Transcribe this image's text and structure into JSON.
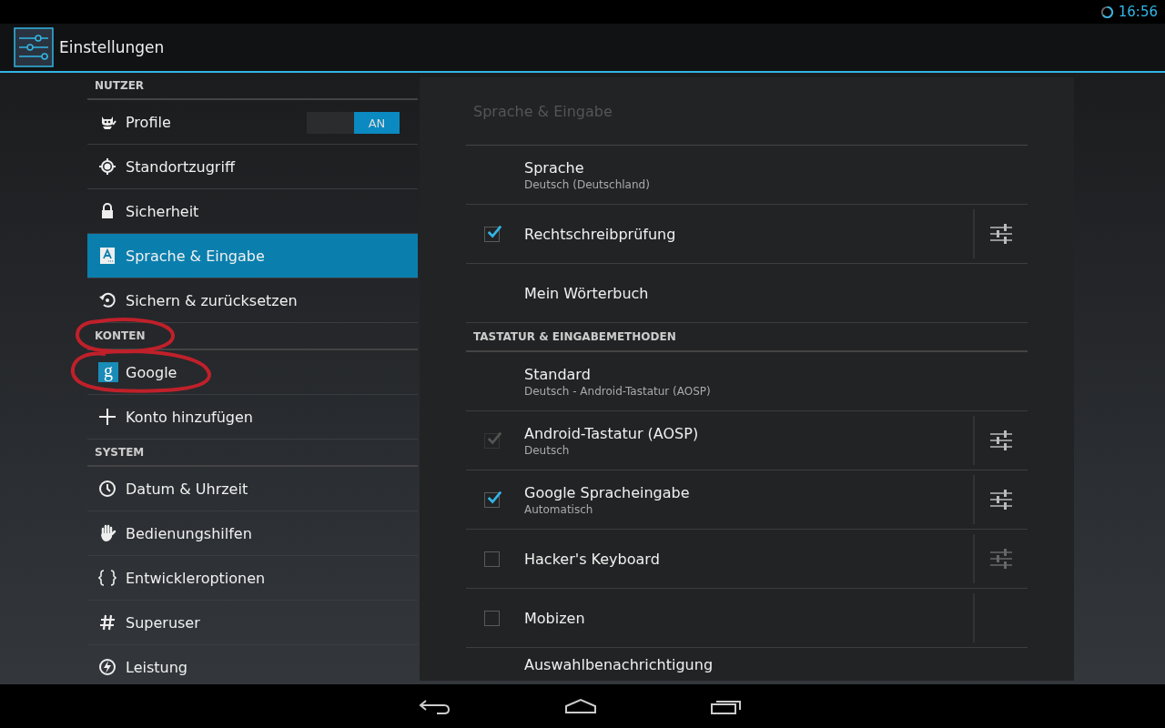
{
  "status_bar": {
    "time": "16:56"
  },
  "action_bar": {
    "title": "Einstellungen"
  },
  "sidebar": {
    "items": [
      {
        "kind": "header",
        "label": "NUTZER",
        "circled": false
      },
      {
        "kind": "item",
        "label": "Profile",
        "selected": false,
        "circled": false,
        "toggle": {
          "label": "AN",
          "on": true
        }
      },
      {
        "kind": "item",
        "label": "Standortzugriff",
        "selected": false,
        "circled": false
      },
      {
        "kind": "item",
        "label": "Sicherheit",
        "selected": false,
        "circled": false
      },
      {
        "kind": "item",
        "label": "Sprache & Eingabe",
        "selected": true,
        "circled": false
      },
      {
        "kind": "item",
        "label": "Sichern & zurücksetzen",
        "selected": false,
        "circled": false
      },
      {
        "kind": "header",
        "label": "KONTEN",
        "circled": true
      },
      {
        "kind": "item",
        "glyph": "g",
        "label": "Google",
        "selected": false,
        "circled": true
      },
      {
        "kind": "item",
        "label": "Konto hinzufügen",
        "selected": false,
        "circled": false
      },
      {
        "kind": "header",
        "label": "SYSTEM",
        "circled": false
      },
      {
        "kind": "item",
        "label": "Datum & Uhrzeit",
        "selected": false,
        "circled": false
      },
      {
        "kind": "item",
        "label": "Bedienungshilfen",
        "selected": false,
        "circled": false
      },
      {
        "kind": "item",
        "label": "Entwickleroptionen",
        "selected": false,
        "circled": false
      },
      {
        "kind": "item",
        "label": "Superuser",
        "selected": false,
        "circled": false
      },
      {
        "kind": "item",
        "label": "Leistung",
        "selected": false,
        "circled": false
      }
    ]
  },
  "panel": {
    "title": "Sprache & Eingabe",
    "rows": [
      {
        "kind": "text",
        "title": "Sprache",
        "subtitle": "Deutsch (Deutschland)"
      },
      {
        "kind": "check",
        "title": "Rechtschreibprüfung",
        "checked": true,
        "disabled": false,
        "settings": true
      },
      {
        "kind": "text",
        "title": "Mein Wörterbuch"
      },
      {
        "kind": "header",
        "title": "TASTATUR & EINGABEMETHODEN"
      },
      {
        "kind": "text",
        "title": "Standard",
        "subtitle": "Deutsch - Android-Tastatur (AOSP)"
      },
      {
        "kind": "check",
        "title": "Android-Tastatur (AOSP)",
        "subtitle": "Deutsch",
        "checked": true,
        "disabled": true,
        "settings": true
      },
      {
        "kind": "check",
        "title": "Google Spracheingabe",
        "subtitle": "Automatisch",
        "checked": true,
        "disabled": false,
        "settings": true
      },
      {
        "kind": "check",
        "title": "Hacker's Keyboard",
        "checked": false,
        "disabled": false,
        "settings": true
      },
      {
        "kind": "check",
        "title": "Mobizen",
        "checked": false,
        "disabled": false,
        "settings": false
      },
      {
        "kind": "cut",
        "title": "Auswahlbenachrichtigung"
      }
    ]
  }
}
